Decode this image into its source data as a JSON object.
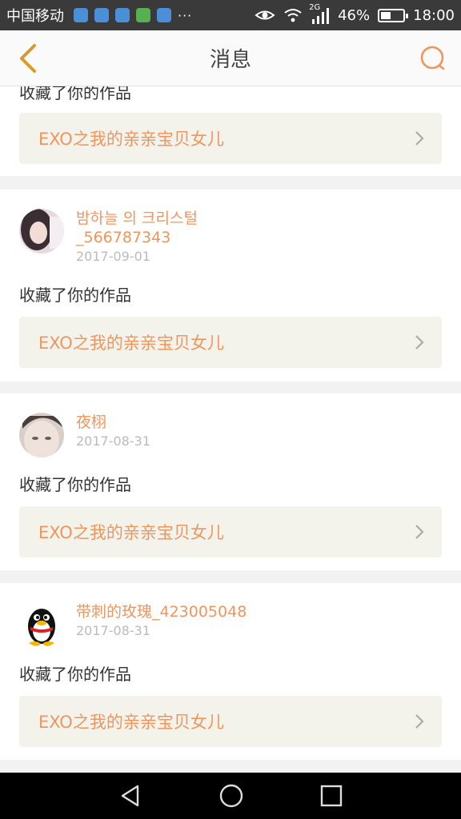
{
  "status_bar": {
    "carrier": "中国移动",
    "overflow": "···",
    "network": "2G",
    "battery": "46%",
    "battery_level": 0.46,
    "time": "18:00"
  },
  "header": {
    "title": "消息"
  },
  "partial_card": {
    "action": "收藏了你的作品",
    "work_title": "EXO之我的亲亲宝贝女儿"
  },
  "messages": [
    {
      "name": "밤하늘 의 크리스털",
      "name_line2": "_566787343",
      "date": "2017-09-01",
      "action": "收藏了你的作品",
      "work_title": "EXO之我的亲亲宝贝女儿"
    },
    {
      "name": "夜栩",
      "date": "2017-08-31",
      "action": "收藏了你的作品",
      "work_title": "EXO之我的亲亲宝贝女儿"
    },
    {
      "name": "带刺的玫瑰_423005048",
      "date": "2017-08-31",
      "action": "收藏了你的作品",
      "work_title": "EXO之我的亲亲宝贝女儿"
    }
  ],
  "colors": {
    "accent": "#f0955c",
    "back_arrow": "#d99a2b",
    "status_bar": "#3a3a3a",
    "card_link_bg": "#f3f3ec"
  }
}
